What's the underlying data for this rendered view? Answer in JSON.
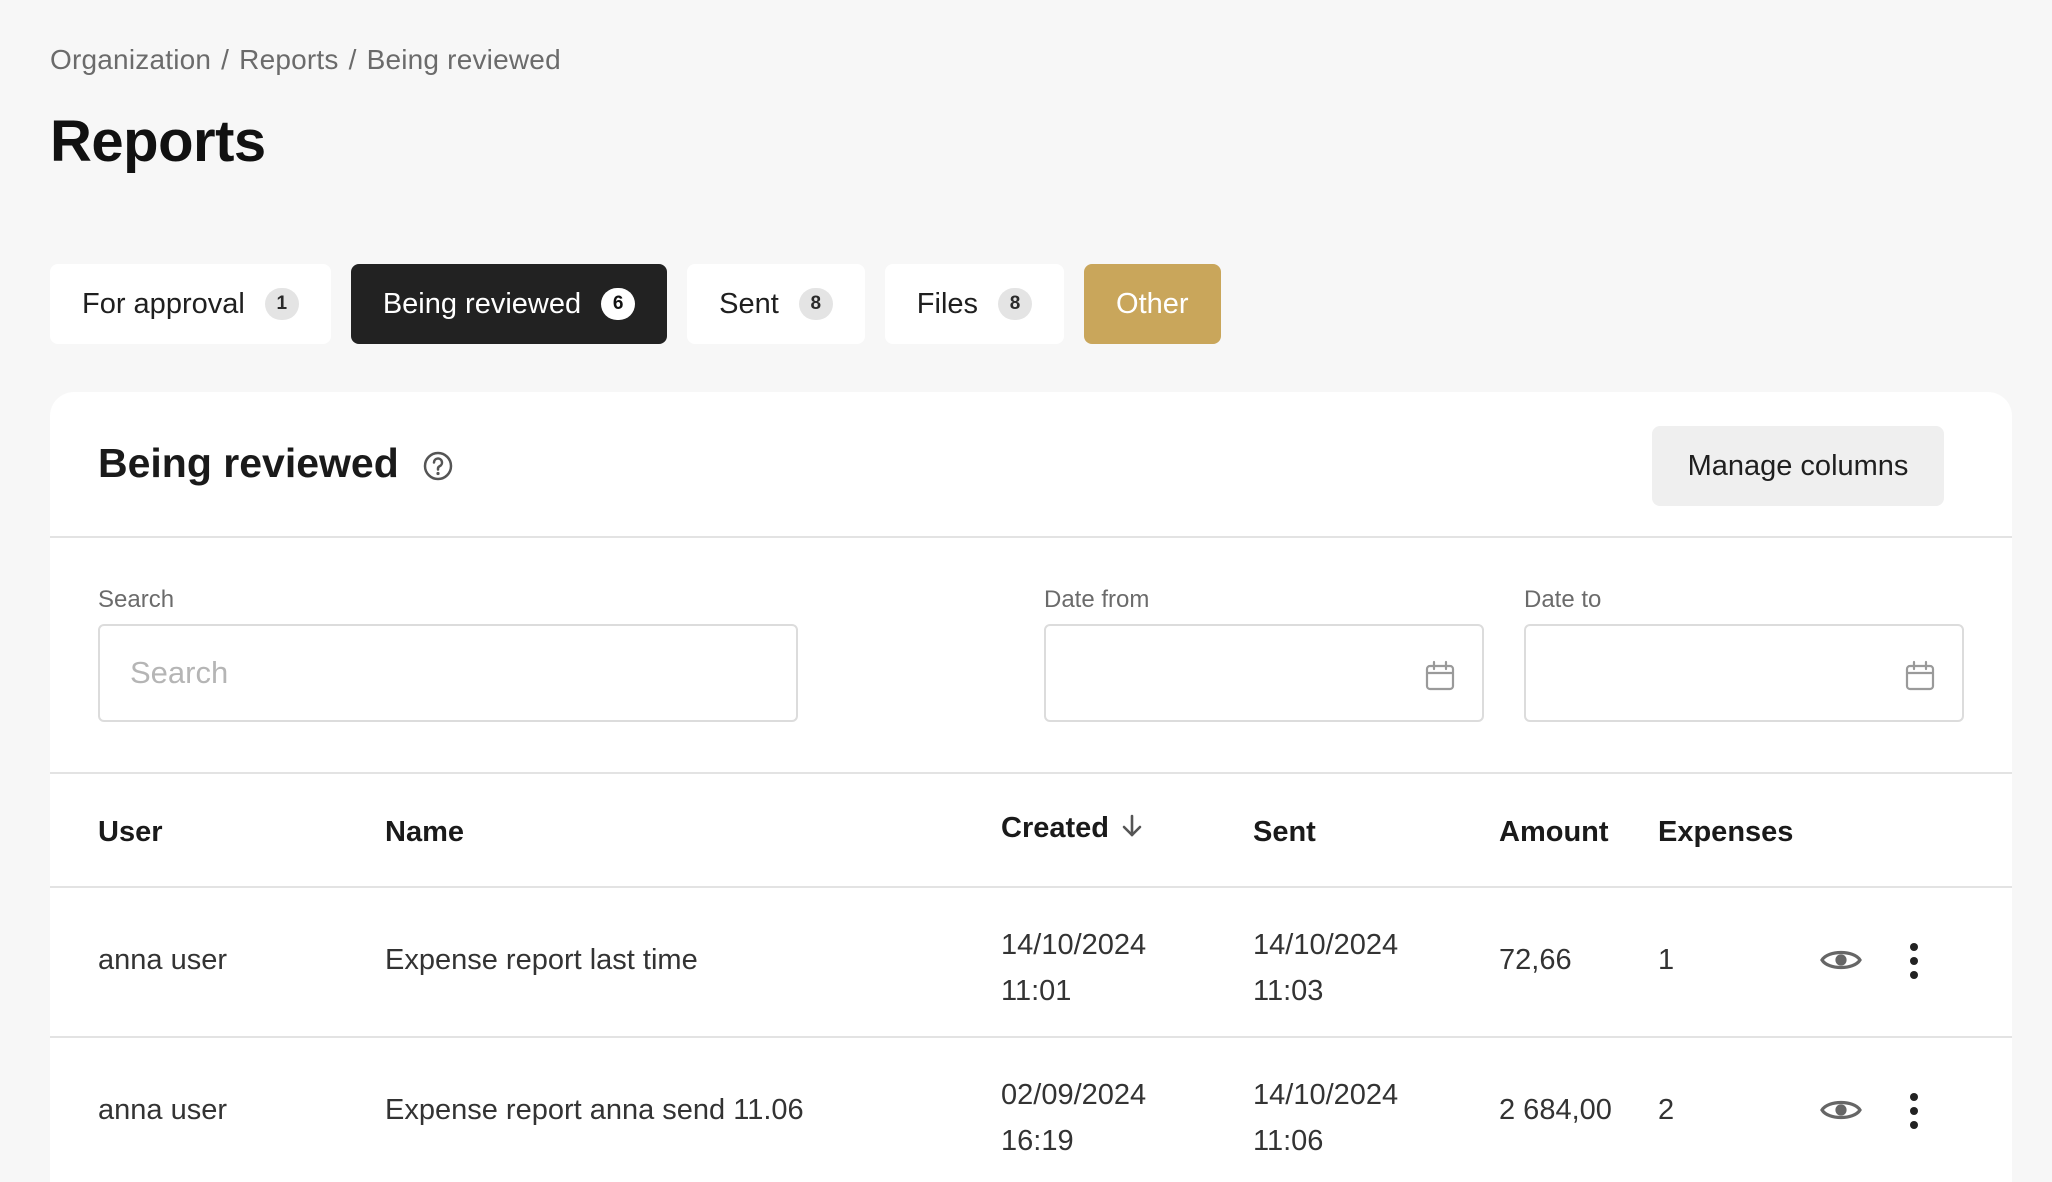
{
  "breadcrumb": [
    "Organization",
    "Reports",
    "Being reviewed"
  ],
  "breadcrumb_separator": "/",
  "page_title": "Reports",
  "tabs": [
    {
      "label": "For approval",
      "count": "1"
    },
    {
      "label": "Being reviewed",
      "count": "6"
    },
    {
      "label": "Sent",
      "count": "8"
    },
    {
      "label": "Files",
      "count": "8"
    },
    {
      "label": "Other"
    }
  ],
  "active_tab": "Being reviewed",
  "card": {
    "title": "Being reviewed",
    "help_icon": "question-circle-icon",
    "manage_columns_label": "Manage columns"
  },
  "filters": {
    "search_label": "Search",
    "search_placeholder": "Search",
    "search_value": "",
    "date_from_label": "Date from",
    "date_from_value": "",
    "date_to_label": "Date to",
    "date_to_value": "",
    "calendar_icon": "calendar-icon"
  },
  "table": {
    "columns": [
      "User",
      "Name",
      "Created",
      "Sent",
      "Amount",
      "Expenses"
    ],
    "sorted_column": "Created",
    "sort_direction": "descending",
    "rows": [
      {
        "user": "anna user",
        "name": "Expense report last time",
        "created_date": "14/10/2024",
        "created_time": "11:01",
        "sent_date": "14/10/2024",
        "sent_time": "11:03",
        "amount": "72,66",
        "expenses": "1"
      },
      {
        "user": "anna user",
        "name": "Expense report anna send 11.06",
        "created_date": "02/09/2024",
        "created_time": "16:19",
        "sent_date": "14/10/2024",
        "sent_time": "11:06",
        "amount": "2 684,00",
        "expenses": "2"
      }
    ],
    "row_action_icons": [
      "eye-icon",
      "more-vertical-icon"
    ]
  },
  "colors": {
    "active_tab_bg": "#222222",
    "other_tab_bg": "#c9a65b",
    "page_bg": "#f7f7f7"
  }
}
